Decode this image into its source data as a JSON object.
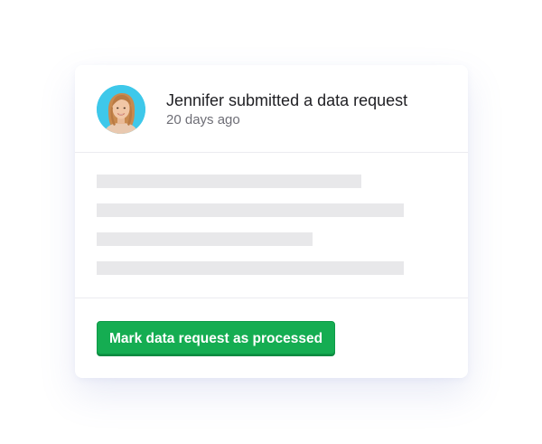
{
  "notification": {
    "title": "Jennifer submitted a data request",
    "timestamp": "20 days ago",
    "avatar_icon": "user-avatar-photo",
    "avatar_bg": "#3ec8ea"
  },
  "body": {
    "placeholder_color": "#e8e8ea"
  },
  "actions": {
    "primary_label": "Mark data request as processed",
    "primary_color": "#15ad52"
  }
}
